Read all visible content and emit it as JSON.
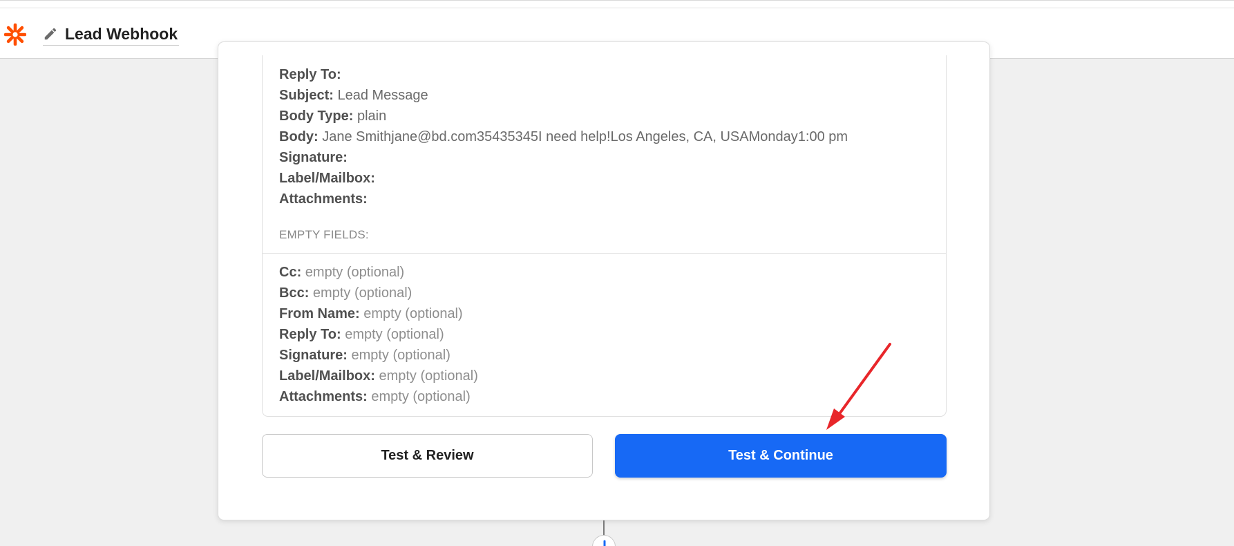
{
  "header": {
    "title": "Lead Webhook"
  },
  "fields": [
    {
      "label": "Reply To:",
      "value": ""
    },
    {
      "label": "Subject:",
      "value": "Lead Message"
    },
    {
      "label": "Body Type:",
      "value": "plain"
    },
    {
      "label": "Body:",
      "value": "Jane Smithjane@bd.com35435345I need help!Los Angeles, CA, USAMonday1:00 pm"
    },
    {
      "label": "Signature:",
      "value": ""
    },
    {
      "label": "Label/Mailbox:",
      "value": ""
    },
    {
      "label": "Attachments:",
      "value": ""
    }
  ],
  "empty_fields": {
    "heading": "EMPTY FIELDS:",
    "items": [
      {
        "label": "Cc:",
        "value": "empty (optional)"
      },
      {
        "label": "Bcc:",
        "value": "empty (optional)"
      },
      {
        "label": "From Name:",
        "value": "empty (optional)"
      },
      {
        "label": "Reply To:",
        "value": "empty (optional)"
      },
      {
        "label": "Signature:",
        "value": "empty (optional)"
      },
      {
        "label": "Label/Mailbox:",
        "value": "empty (optional)"
      },
      {
        "label": "Attachments:",
        "value": "empty (optional)"
      }
    ]
  },
  "buttons": {
    "review_label": "Test & Review",
    "continue_label": "Test & Continue"
  },
  "colors": {
    "brand_orange": "#ff4f00",
    "primary_blue": "#1769f5",
    "annotation_red": "#e8262a",
    "add_step_blue": "#1769f5"
  },
  "icons": {
    "logo": "zapier-asterisk-icon",
    "edit": "pencil-icon",
    "add_step": "plus-icon",
    "annotation": "red-arrow"
  }
}
